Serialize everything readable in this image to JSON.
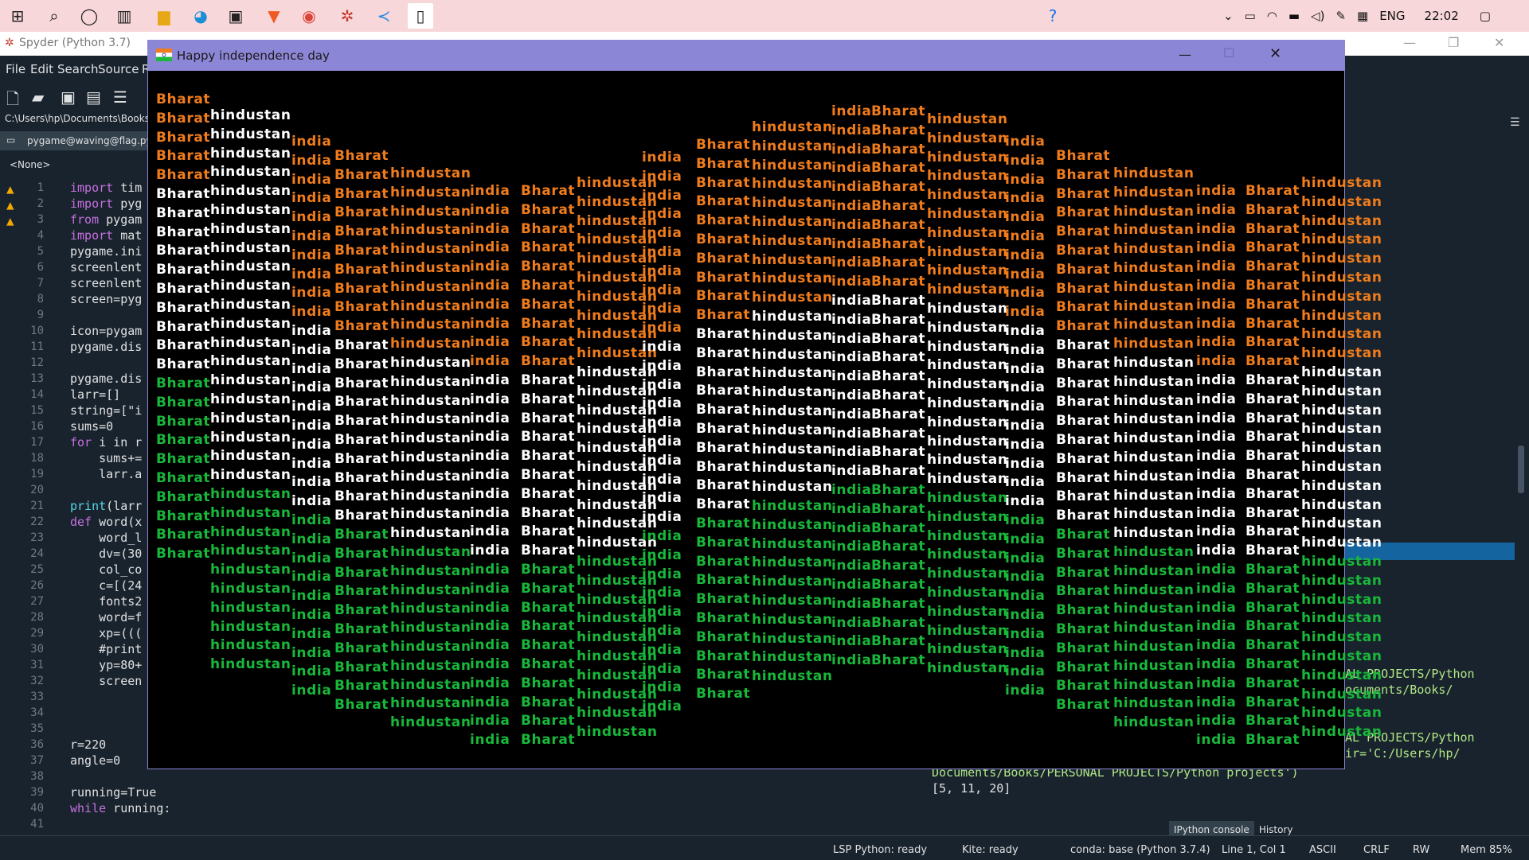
{
  "taskbar": {
    "lang": "ENG",
    "time": "22:02"
  },
  "spyder": {
    "title": "Spyder (Python 3.7)",
    "menu": [
      "File",
      "Edit",
      "Search",
      "Source",
      "R"
    ],
    "path": "C:\\Users\\hp\\Documents\\Books\\",
    "file_tab": "pygame@waving@flag.py",
    "outline": "<None>",
    "code_lines": [
      {
        "n": "1",
        "t": "import tim"
      },
      {
        "n": "2",
        "t": "import pyg"
      },
      {
        "n": "3",
        "t": "from pygam"
      },
      {
        "n": "4",
        "t": "import mat"
      },
      {
        "n": "5",
        "t": "pygame.ini"
      },
      {
        "n": "6",
        "t": "screenlent"
      },
      {
        "n": "7",
        "t": "screenlent"
      },
      {
        "n": "8",
        "t": "screen=pyg"
      },
      {
        "n": "9",
        "t": ""
      },
      {
        "n": "10",
        "t": "icon=pygam"
      },
      {
        "n": "11",
        "t": "pygame.dis"
      },
      {
        "n": "12",
        "t": ""
      },
      {
        "n": "13",
        "t": "pygame.dis"
      },
      {
        "n": "14",
        "t": "larr=[]"
      },
      {
        "n": "15",
        "t": "string=[\"i"
      },
      {
        "n": "16",
        "t": "sums=0"
      },
      {
        "n": "17",
        "t": "for i in r"
      },
      {
        "n": "18",
        "t": "    sums+="
      },
      {
        "n": "19",
        "t": "    larr.a"
      },
      {
        "n": "20",
        "t": "    "
      },
      {
        "n": "21",
        "t": "print(larr"
      },
      {
        "n": "22",
        "t": "def word(x"
      },
      {
        "n": "23",
        "t": "    word_l"
      },
      {
        "n": "24",
        "t": "    dv=(30"
      },
      {
        "n": "25",
        "t": "    col_co"
      },
      {
        "n": "26",
        "t": "    c=[(24"
      },
      {
        "n": "27",
        "t": "    fonts2"
      },
      {
        "n": "28",
        "t": "    word=f"
      },
      {
        "n": "29",
        "t": "    xp=((("
      },
      {
        "n": "30",
        "t": "    #print"
      },
      {
        "n": "31",
        "t": "    yp=80+"
      },
      {
        "n": "32",
        "t": "    screen"
      },
      {
        "n": "33",
        "t": "    "
      },
      {
        "n": "34",
        "t": "    "
      },
      {
        "n": "35",
        "t": ""
      },
      {
        "n": "36",
        "t": "r=220"
      },
      {
        "n": "37",
        "t": "angle=0"
      },
      {
        "n": "38",
        "t": ""
      },
      {
        "n": "39",
        "t": "running=True"
      },
      {
        "n": "40",
        "t": "while running:"
      },
      {
        "n": "41",
        "t": "    "
      }
    ],
    "console_lines": [
      "NAL PROJECTS/Python",
      "Documents/Books/",
      "",
      "NAL PROJECTS/Python",
      "dir='C:/Users/hp/",
      "Documents/Books/PERSONAL PROJECTS/Python projects')",
      "[5, 11, 20]"
    ],
    "console_tabs": [
      "IPython console",
      "History"
    ],
    "status": {
      "lsp": "LSP Python: ready",
      "kite": "Kite: ready",
      "conda": "conda: base (Python 3.7.4)",
      "pos": "Line 1, Col 1",
      "enc": "ASCII",
      "eol": "CRLF",
      "rw": "RW",
      "mem": "Mem 85%"
    }
  },
  "pygame_window": {
    "title": "Happy independence day",
    "columns": [
      {
        "word": "Bharat",
        "orange": 5,
        "white": 10,
        "green": 10
      },
      {
        "word": "hindustan",
        "orange": 0,
        "white": 20,
        "green": 10
      },
      {
        "word": "india",
        "orange": 10,
        "white": 10,
        "green": 10
      },
      {
        "word": "Bharat",
        "orange": 10,
        "white": 10,
        "green": 10
      },
      {
        "word": "hindustan",
        "orange": 10,
        "white": 10,
        "green": 10
      },
      {
        "word": "india",
        "orange": 10,
        "white": 10,
        "green": 10
      },
      {
        "word": "Bharat",
        "orange": 10,
        "white": 10,
        "green": 10
      },
      {
        "word": "hindustan",
        "orange": 10,
        "white": 10,
        "green": 10
      },
      {
        "word": "india",
        "orange": 10,
        "white": 10,
        "green": 10
      },
      {
        "word": "Bharat",
        "orange": 10,
        "white": 10,
        "green": 10
      },
      {
        "word": "hindustan",
        "orange": 10,
        "white": 10,
        "green": 10
      },
      {
        "word": "india",
        "orange": 10,
        "white": 10,
        "green": 10
      },
      {
        "word": "Bharat",
        "orange": 10,
        "white": 10,
        "green": 10
      },
      {
        "word": "hindustan",
        "orange": 10,
        "white": 10,
        "green": 10
      },
      {
        "word": "india",
        "orange": 10,
        "white": 10,
        "green": 10
      },
      {
        "word": "Bharat",
        "orange": 10,
        "white": 10,
        "green": 10
      },
      {
        "word": "hindustan",
        "orange": 10,
        "white": 10,
        "green": 10
      },
      {
        "word": "india",
        "orange": 10,
        "white": 10,
        "green": 10
      },
      {
        "word": "Bharat",
        "orange": 10,
        "white": 10,
        "green": 10
      },
      {
        "word": "hindustan",
        "orange": 10,
        "white": 10,
        "green": 10
      }
    ]
  }
}
